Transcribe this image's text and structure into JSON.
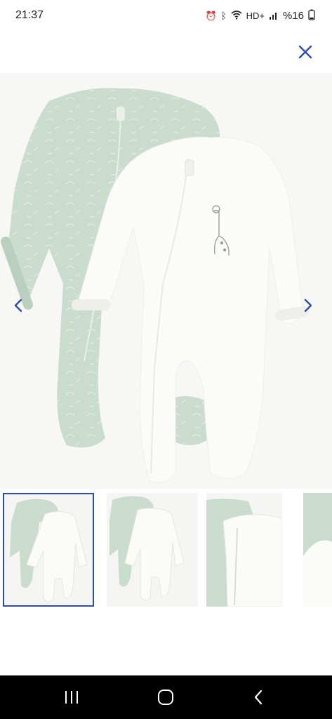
{
  "status_bar": {
    "time": "21:37",
    "network": "HD+",
    "battery": "%16",
    "icons": [
      "alarm-icon",
      "bluetooth-icon",
      "wifi-icon",
      "signal-icon"
    ]
  },
  "header": {
    "close_icon": "close-icon"
  },
  "gallery": {
    "prev_icon": "chevron-left-icon",
    "next_icon": "chevron-right-icon",
    "thumbnails": [
      {
        "name": "front view",
        "selected": true
      },
      {
        "name": "back view",
        "selected": false
      },
      {
        "name": "detail view",
        "selected": false
      },
      {
        "name": "fabric close-up",
        "selected": false
      }
    ]
  },
  "colors": {
    "accent": "#2d4ea6",
    "sage": "#c9dccd",
    "ivory": "#fbfbf7"
  },
  "system_nav": {
    "recent_icon": "recent-apps-icon",
    "home_icon": "home-icon",
    "back_icon": "back-icon"
  }
}
